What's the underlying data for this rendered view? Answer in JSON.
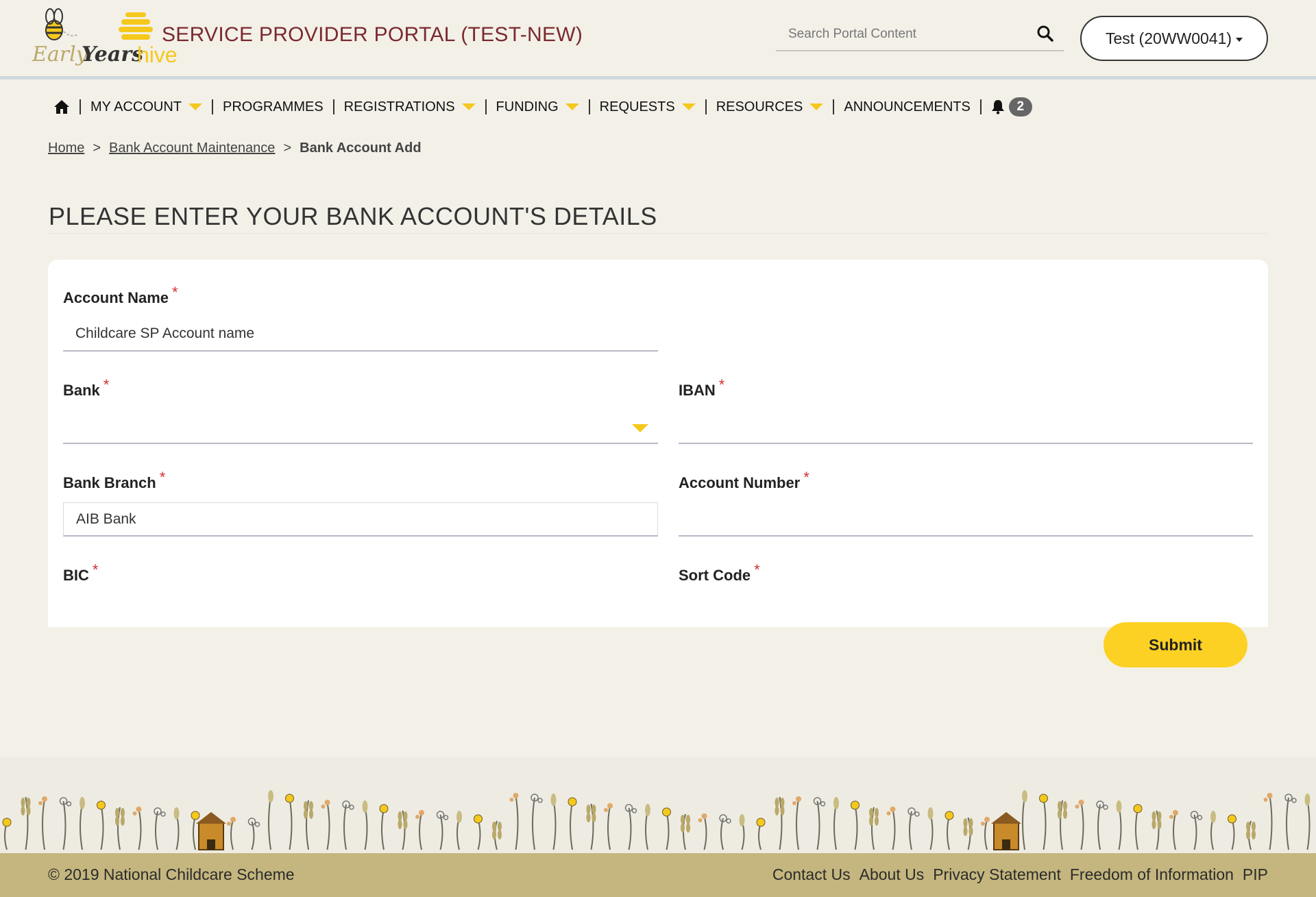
{
  "header": {
    "logo_word_early": "Early",
    "logo_word_years": "Years",
    "logo_word_hive": "hive",
    "portal_title": "SERVICE PROVIDER PORTAL (TEST-NEW)",
    "search_placeholder": "Search Portal Content",
    "user_label": "Test (20WW0041)"
  },
  "nav": {
    "items": [
      {
        "label": "MY ACCOUNT",
        "dropdown": true
      },
      {
        "label": "PROGRAMMES",
        "dropdown": false
      },
      {
        "label": "REGISTRATIONS",
        "dropdown": true
      },
      {
        "label": "FUNDING",
        "dropdown": true
      },
      {
        "label": "REQUESTS",
        "dropdown": true
      },
      {
        "label": "RESOURCES",
        "dropdown": true
      },
      {
        "label": "ANNOUNCEMENTS",
        "dropdown": false
      }
    ],
    "notification_count": "2"
  },
  "breadcrumb": {
    "home": "Home",
    "parent": "Bank Account Maintenance",
    "current": "Bank Account Add",
    "separator": ">"
  },
  "page": {
    "title": "PLEASE ENTER YOUR BANK ACCOUNT'S DETAILS"
  },
  "form": {
    "required_mark": "*",
    "account_name": {
      "label": "Account Name",
      "value": "Childcare SP Account name"
    },
    "bank": {
      "label": "Bank",
      "value": ""
    },
    "iban": {
      "label": "IBAN",
      "value": ""
    },
    "bank_branch": {
      "label": "Bank Branch",
      "value": "AIB Bank"
    },
    "account_number": {
      "label": "Account Number",
      "value": ""
    },
    "bic": {
      "label": "BIC"
    },
    "sort_code": {
      "label": "Sort Code"
    },
    "submit_label": "Submit"
  },
  "footer": {
    "copyright": "© 2019 National Childcare Scheme",
    "links": [
      "Contact Us",
      "About Us",
      "Privacy Statement",
      "Freedom of Information",
      "PIP"
    ]
  },
  "colors": {
    "accent_yellow": "#fcd123",
    "title_maroon": "#7a2a2f",
    "footer_bar": "#c4b67e",
    "required_red": "#d12f2f",
    "page_bg": "#f3f0e8"
  }
}
